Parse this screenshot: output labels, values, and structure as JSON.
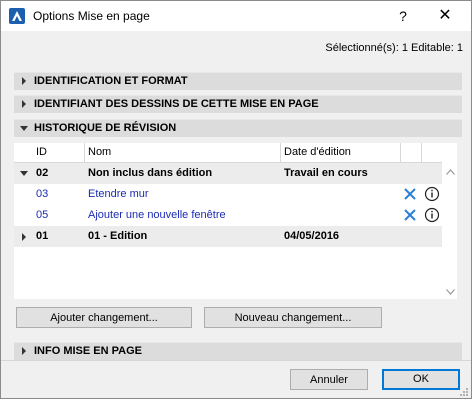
{
  "window": {
    "title": "Options Mise en page",
    "help_label": "?",
    "close_label": "✕"
  },
  "status": {
    "text": "Sélectionné(s): 1 Editable: 1"
  },
  "sections": {
    "identification": "IDENTIFICATION ET FORMAT",
    "identifiant": "IDENTIFIANT DES DESSINS DE CETTE MISE EN PAGE",
    "historique": "HISTORIQUE DE RÉVISION",
    "info": "INFO MISE EN PAGE"
  },
  "table": {
    "columns": [
      "ID",
      "Nom",
      "Date d'édition"
    ],
    "rows": [
      {
        "id": "02",
        "name": "Non inclus dans édition",
        "date": "Travail en cours"
      },
      {
        "id": "03",
        "name": "Etendre mur",
        "date": ""
      },
      {
        "id": "05",
        "name": "Ajouter une nouvelle fenêtre",
        "date": ""
      },
      {
        "id": "01",
        "name": "01 - Edition",
        "date": "04/05/2016"
      }
    ]
  },
  "buttons": {
    "add_change": "Ajouter changement...",
    "new_change": "Nouveau changement...",
    "cancel": "Annuler",
    "ok": "OK"
  },
  "colors": {
    "change_text": "#1a2bb5",
    "delete_icon": "#2b7fd4",
    "ok_border": "#0078d7"
  }
}
